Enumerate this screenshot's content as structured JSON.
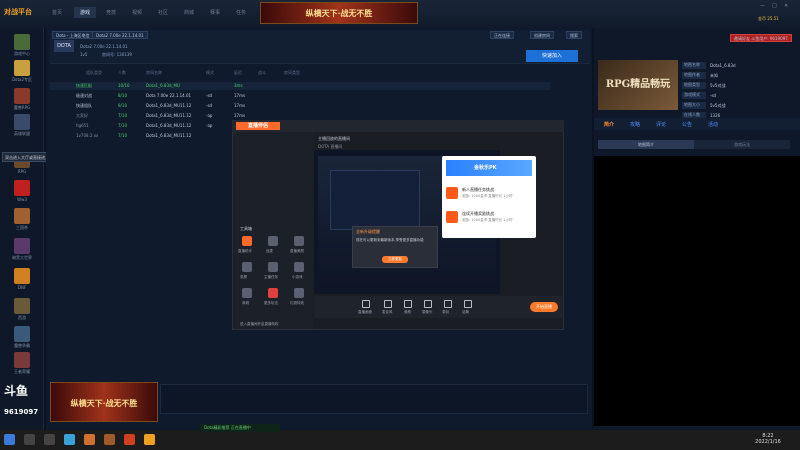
{
  "app": {
    "logo_text": "对战平台",
    "tabs": [
      "首页",
      "游戏",
      "竞技",
      "视频",
      "社区",
      "商城",
      "赛事",
      "任务",
      "直播"
    ],
    "active_tab": 1,
    "banner_text": "纵横天下·战无不胜",
    "top_right": "金币 25.51",
    "window_controls": [
      "—",
      "□",
      "✕"
    ]
  },
  "sidebar": {
    "items": [
      "游戏中心",
      "Dota2专区",
      "魔兽RPG",
      "英雄联盟",
      "刀塔传奇",
      "RPG",
      "Ww3",
      "三国杀",
      "暗黑大世界",
      "DNF",
      "西游",
      "魔兽争霸",
      "王者荣耀",
      "Dota"
    ]
  },
  "toolbar": {
    "region": "Dota - 上海区电信",
    "server": "Dota2 7.00e 22.1.14.01",
    "game": "DOTA",
    "count": "1v5",
    "status": "正在连接",
    "fast_join": "快速加入",
    "room_label": "房间号: 130139",
    "create_room": "创建房间",
    "search": "搜索"
  },
  "table": {
    "headers": [
      "组队类型",
      "人数",
      "房间名称",
      "模式",
      "延迟",
      "战斗",
      "房间类型"
    ],
    "rows": [
      [
        "快速匹配",
        "10/10",
        "Dota1_6.83d_MU",
        "",
        "",
        "3ms",
        "",
        ""
      ],
      [
        "极速对战",
        "8/10",
        "Dota 7.00e 22.1.14.01",
        "-sd",
        "",
        "17ms",
        "",
        ""
      ],
      [
        "快速组队",
        "9/10",
        "Dota1_6.83d_MU11.12",
        "-sd",
        "",
        "17ms",
        "",
        ""
      ],
      [
        "大家好",
        "7/10",
        "Dota1_6.83d_MU11.12",
        "-ap",
        "",
        "17ms",
        "",
        ""
      ],
      [
        "hg651",
        "7/10",
        "Dota1_6.83d_MU11.12",
        "-ap",
        "",
        "17ms",
        "",
        ""
      ],
      [
        "1v708.2.xx",
        "7/10",
        "Dota1_6.83d_MU11.12",
        "",
        "",
        "17ms",
        "",
        ""
      ]
    ]
  },
  "overlay": {
    "app_name": "直播伴侣",
    "tabs": [
      "直播",
      "设置",
      "更多"
    ],
    "title": "主播回放的直播间",
    "room": "DOTA 直播间",
    "tool_label": "工具箱",
    "tools": [
      "直播助手",
      "连麦",
      "直播美颜",
      "录屏",
      "主播任务",
      "小游戏",
      "商城",
      "更多玩法",
      "礼物特效",
      "粉丝团",
      "主播工具"
    ],
    "bottom": [
      "直播画面",
      "麦克风",
      "美颜",
      "摄像头",
      "录制",
      "话筒"
    ],
    "start_live": "开始直播",
    "bottom_note": "进入直播间开启直播特权"
  },
  "popup": {
    "title": "金秋乐PK",
    "items": [
      {
        "title": "新人直播任务挑战",
        "sub": "奖励: 1000金币 直播时长 1小时"
      },
      {
        "title": "连续开播奖励挑战",
        "sub": "奖励: 1000金币 直播时长 2小时"
      }
    ]
  },
  "dialog": {
    "title": "全新升级提醒",
    "text": "现在可以更新到最新版本,享受更多直播功能",
    "button": "立即更新"
  },
  "stream": {
    "platform": "斗鱼",
    "room_id": "9619097",
    "banner_text": "纵横天下·战无不胜"
  },
  "tooltip": "双击进入大厅或直接进入游戏房间",
  "right": {
    "header": "邀请好友 斗鱼用户: 9619097",
    "rpg_badge": "RPG精品畅玩",
    "info": [
      [
        "地图名称",
        "Dota1_6.83d"
      ],
      [
        "地图作者",
        "未知"
      ],
      [
        "地图类型",
        "5v5对战"
      ],
      [
        "游戏模式",
        "-sd"
      ],
      [
        "地图大小",
        "5v5对战"
      ],
      [
        "在线人数",
        "1326"
      ]
    ],
    "tabs": [
      "简介",
      "攻略",
      "评论",
      "公告",
      "活动"
    ],
    "sub_tabs": [
      "地图简介",
      "游戏玩法"
    ]
  },
  "taskbar": {
    "time": "8:22",
    "date": "2022/1/16",
    "notify": "Dota精彩推荐 正在直播中"
  },
  "colors": {
    "accent": "#1f6fd8",
    "highlight": "#ff7a2a",
    "bg": "#0b1322"
  }
}
